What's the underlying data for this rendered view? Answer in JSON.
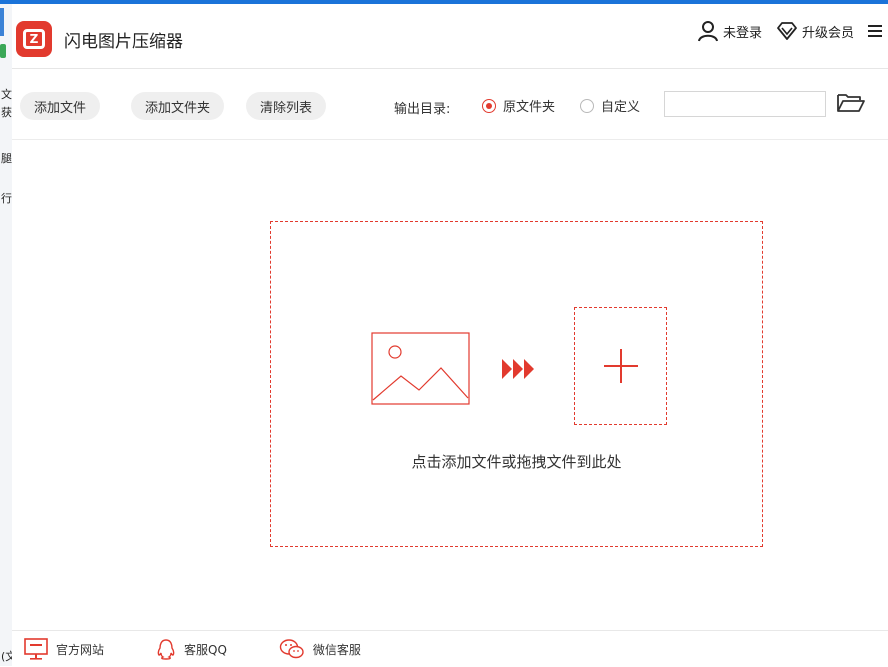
{
  "app": {
    "title": "闪电图片压缩器",
    "logo_icon": "lightning-compress-logo-icon",
    "brand_color": "#e23a2e"
  },
  "header": {
    "login_label": "未登录",
    "upgrade_label": "升级会员",
    "icons": [
      "user-icon",
      "diamond-icon",
      "menu-icon"
    ]
  },
  "toolbar": {
    "add_file_label": "添加文件",
    "add_folder_label": "添加文件夹",
    "clear_list_label": "清除列表",
    "output_dir_label": "输出目录:",
    "option_original_label": "原文件夹",
    "option_custom_label": "自定义",
    "selected_option": "原文件夹",
    "path_value": "",
    "folder_icon": "folder-open-icon"
  },
  "dropzone": {
    "hint": "点击添加文件或拖拽文件到此处",
    "icons": [
      "image-icon",
      "triple-arrow-icon",
      "plus-icon"
    ]
  },
  "footer": {
    "website_label": "官方网站",
    "qq_label": "客服QQ",
    "wechat_label": "微信客服",
    "icons": [
      "monitor-icon",
      "qq-penguin-icon",
      "wechat-icon"
    ]
  },
  "background_window": {
    "fragments": [
      "文",
      "获",
      "腿",
      "行",
      "(文"
    ],
    "accent_colors": [
      "#3b82d6",
      "#3aa757"
    ]
  }
}
